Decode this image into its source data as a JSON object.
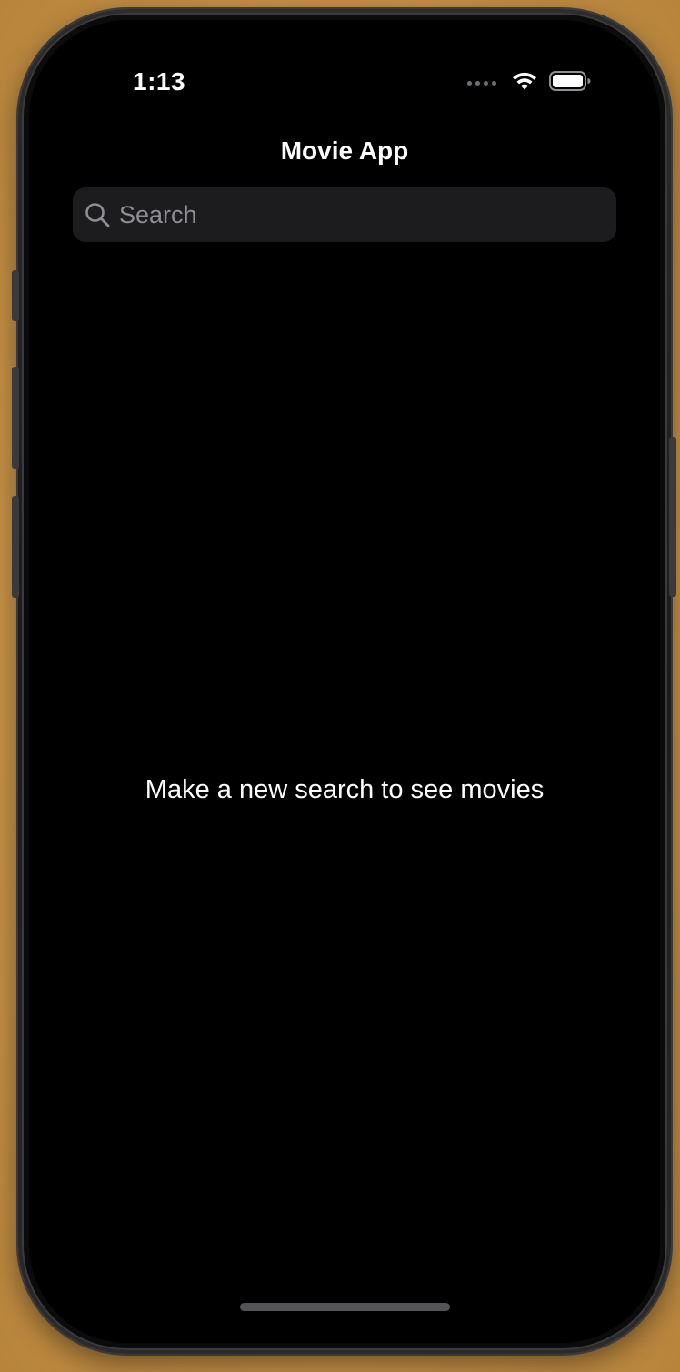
{
  "status_bar": {
    "time": "1:13",
    "wifi_icon": "wifi-icon",
    "battery_icon": "battery-icon",
    "signal_icon": "cellular-dots-icon"
  },
  "nav": {
    "title": "Movie App"
  },
  "search": {
    "placeholder": "Search",
    "value": "",
    "icon": "search-icon"
  },
  "main": {
    "empty_message": "Make a new search to see movies"
  },
  "colors": {
    "background": "#000000",
    "search_field": "#1c1c1e",
    "placeholder": "#8e8e93",
    "text": "#ffffff"
  }
}
